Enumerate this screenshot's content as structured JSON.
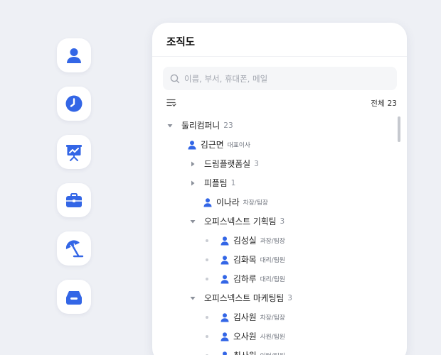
{
  "colors": {
    "accent": "#3366e6",
    "background": "#eef0f5"
  },
  "sidebar": {
    "items": [
      {
        "icon": "person-icon"
      },
      {
        "icon": "clock-icon"
      },
      {
        "icon": "presentation-chart-icon"
      },
      {
        "icon": "briefcase-icon"
      },
      {
        "icon": "beach-umbrella-icon"
      },
      {
        "icon": "inbox-icon"
      }
    ]
  },
  "panel": {
    "title": "조직도",
    "search": {
      "placeholder": "이름, 부서, 휴대폰, 메일",
      "value": ""
    },
    "total_label": "전체",
    "total_count": "23"
  },
  "tree": {
    "root": {
      "label": "둘리컴퍼니",
      "count": "23",
      "expanded": true
    },
    "ceo": {
      "name": "김근면",
      "role": "대표이사"
    },
    "depts": [
      {
        "label": "드림플랫폼실",
        "count": "3",
        "expanded": false
      },
      {
        "label": "피플팀",
        "count": "1",
        "expanded": false,
        "members": [
          {
            "name": "이나라",
            "role": "차장/팀장"
          }
        ]
      },
      {
        "label": "오피스넥스트 기획팀",
        "count": "3",
        "expanded": true,
        "members": [
          {
            "name": "김성실",
            "role": "과장/팀장"
          },
          {
            "name": "김화목",
            "role": "대리/팀원"
          },
          {
            "name": "김하루",
            "role": "대리/팀원"
          }
        ]
      },
      {
        "label": "오피스넥스트 마케팅팀",
        "count": "3",
        "expanded": true,
        "members": [
          {
            "name": "김사원",
            "role": "차장/팀장"
          },
          {
            "name": "오사원",
            "role": "사원/팀원"
          },
          {
            "name": "최사원",
            "role": "인턴/팀원"
          }
        ]
      }
    ]
  }
}
